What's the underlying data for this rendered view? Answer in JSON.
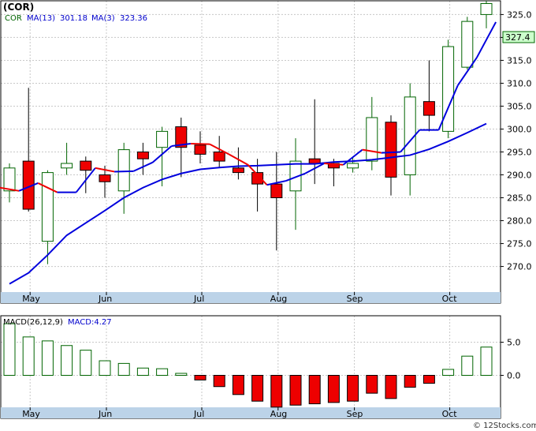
{
  "chart_data": {
    "type": "candlestick",
    "title": "(COR)",
    "credit": "© 12Stocks.com",
    "colors": {
      "up_candle_fill": "#ffffff",
      "up_candle_stroke": "#006400",
      "down_candle_fill": "#ee0000",
      "ma_fast_up": "#0000dd",
      "ma_fast_down": "#ee0000",
      "ma_slow": "#0000dd",
      "macd_positive_fill": "#ffffff",
      "macd_negative_fill": "#ee0000",
      "axis_band": "#bcd3e8",
      "last_price_box": "#ccffcc",
      "legend_ticker": "#006400",
      "legend_ma": "#0000cc"
    },
    "legend": {
      "ticker": "COR",
      "ma_slow_label": "MA(13)",
      "ma_slow_value": "301.18",
      "ma_fast_label": "MA(3)",
      "ma_fast_value": "323.36"
    },
    "last_price_label": "327.4",
    "y_axis": {
      "ylim": [
        262,
        328
      ],
      "ticks": [
        270,
        275,
        280,
        285,
        290,
        295,
        300,
        305,
        310,
        315,
        320,
        325
      ]
    },
    "x_axis": {
      "labels": [
        "May",
        "Jun",
        "Jul",
        "Aug",
        "Sep",
        "Oct"
      ],
      "label_at_index": [
        1,
        5,
        10,
        14,
        18,
        23
      ]
    },
    "candles": [
      {
        "o": 286.5,
        "h": 292.5,
        "l": 284.0,
        "c": 291.5
      },
      {
        "o": 293.0,
        "h": 309.0,
        "l": 282.0,
        "c": 282.5
      },
      {
        "o": 275.5,
        "h": 291.0,
        "l": 270.5,
        "c": 290.5
      },
      {
        "o": 291.5,
        "h": 297.0,
        "l": 290.0,
        "c": 292.5
      },
      {
        "o": 293.0,
        "h": 294.0,
        "l": 286.0,
        "c": 291.0
      },
      {
        "o": 290.0,
        "h": 292.0,
        "l": 285.0,
        "c": 288.5
      },
      {
        "o": 286.5,
        "h": 297.0,
        "l": 281.5,
        "c": 295.5
      },
      {
        "o": 295.0,
        "h": 297.0,
        "l": 290.0,
        "c": 293.5
      },
      {
        "o": 296.0,
        "h": 300.5,
        "l": 287.5,
        "c": 299.5
      },
      {
        "o": 300.5,
        "h": 302.5,
        "l": 289.5,
        "c": 296.0
      },
      {
        "o": 296.5,
        "h": 299.5,
        "l": 292.5,
        "c": 294.5
      },
      {
        "o": 295.0,
        "h": 298.5,
        "l": 291.5,
        "c": 293.0
      },
      {
        "o": 291.5,
        "h": 296.0,
        "l": 289.0,
        "c": 290.5
      },
      {
        "o": 290.5,
        "h": 293.5,
        "l": 282.0,
        "c": 288.0
      },
      {
        "o": 288.0,
        "h": 295.0,
        "l": 273.5,
        "c": 285.0
      },
      {
        "o": 286.5,
        "h": 298.0,
        "l": 278.0,
        "c": 293.0
      },
      {
        "o": 293.5,
        "h": 306.5,
        "l": 288.0,
        "c": 292.5
      },
      {
        "o": 292.5,
        "h": 293.5,
        "l": 287.5,
        "c": 291.5
      },
      {
        "o": 291.5,
        "h": 294.0,
        "l": 290.5,
        "c": 292.5
      },
      {
        "o": 293.0,
        "h": 307.0,
        "l": 291.0,
        "c": 302.5
      },
      {
        "o": 301.5,
        "h": 303.0,
        "l": 285.5,
        "c": 289.5
      },
      {
        "o": 290.0,
        "h": 310.0,
        "l": 285.5,
        "c": 307.0
      },
      {
        "o": 306.0,
        "h": 315.0,
        "l": 299.5,
        "c": 303.0
      },
      {
        "o": 299.5,
        "h": 319.5,
        "l": 298.0,
        "c": 318.0
      },
      {
        "o": 313.5,
        "h": 324.5,
        "l": 313.0,
        "c": 323.5
      },
      {
        "o": 325.0,
        "h": 328.0,
        "l": 322.0,
        "c": 327.4
      }
    ],
    "ma_fast": [
      287.2,
      286.5,
      288.2,
      286.2,
      286.2,
      291.5,
      290.7,
      290.8,
      292.7,
      296.3,
      296.8,
      296.7,
      294.5,
      292.2,
      287.8,
      288.7,
      290.3,
      292.5,
      292.2,
      295.5,
      294.8,
      295.0,
      299.8,
      299.8,
      309.5,
      315.6,
      323.36
    ],
    "ma_slow": [
      266.2,
      268.6,
      272.5,
      276.8,
      279.5,
      282.2,
      285.0,
      287.2,
      289.0,
      290.3,
      291.2,
      291.6,
      291.9,
      292.0,
      292.2,
      292.4,
      292.4,
      292.8,
      293.0,
      293.3,
      293.8,
      294.3,
      295.6,
      297.3,
      299.2,
      301.18
    ],
    "macd": {
      "label": "MACD(26,12,9)",
      "value_label": "MACD:4.27",
      "ylim": [
        -6.5,
        9
      ],
      "ticks": [
        0.0,
        5.0
      ],
      "tick_labels": [
        "0.0",
        "5.0"
      ],
      "values": [
        7.8,
        5.8,
        5.2,
        4.5,
        3.8,
        2.2,
        1.8,
        1.1,
        1.0,
        0.3,
        -0.7,
        -1.7,
        -2.9,
        -3.9,
        -4.8,
        -4.5,
        -4.3,
        -4.1,
        -3.9,
        -2.7,
        -3.5,
        -1.8,
        -1.2,
        0.9,
        2.9,
        4.27
      ]
    }
  }
}
